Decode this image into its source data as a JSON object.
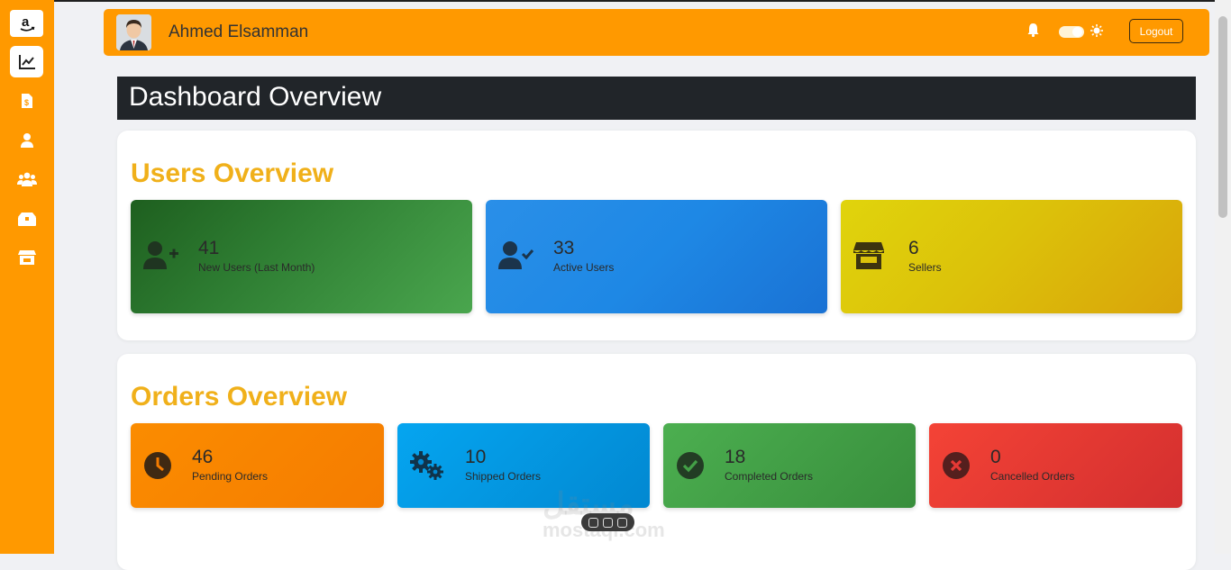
{
  "header": {
    "user_name": "Ahmed Elsamman",
    "logout_label": "Logout"
  },
  "page_title": "Dashboard Overview",
  "users_overview": {
    "title": "Users Overview",
    "cards": [
      {
        "value": "41",
        "label": "New Users (Last Month)",
        "icon": "user-plus-icon",
        "color": "#2e7d32"
      },
      {
        "value": "33",
        "label": "Active Users",
        "icon": "user-check-icon",
        "color": "#1e88e5"
      },
      {
        "value": "6",
        "label": "Sellers",
        "icon": "store-icon",
        "color": "#dcc20a"
      }
    ]
  },
  "orders_overview": {
    "title": "Orders Overview",
    "cards": [
      {
        "value": "46",
        "label": "Pending Orders",
        "icon": "clock-icon",
        "color": "#f57c00"
      },
      {
        "value": "10",
        "label": "Shipped Orders",
        "icon": "gears-icon",
        "color": "#0288d1"
      },
      {
        "value": "18",
        "label": "Completed Orders",
        "icon": "check-circle-icon",
        "color": "#43a047"
      },
      {
        "value": "0",
        "label": "Cancelled Orders",
        "icon": "times-circle-icon",
        "color": "#e53935"
      }
    ]
  },
  "sidebar": {
    "items": [
      {
        "icon": "amazon-logo-icon"
      },
      {
        "icon": "chart-line-icon",
        "active": true
      },
      {
        "icon": "invoice-dollar-icon"
      },
      {
        "icon": "user-icon"
      },
      {
        "icon": "users-icon"
      },
      {
        "icon": "boxes-icon"
      },
      {
        "icon": "store-icon"
      }
    ]
  },
  "watermark": {
    "text": "مستقل",
    "sub": "mostaql.com"
  },
  "colors": {
    "accent": "#ff9900",
    "title_yellow": "#f0b01a",
    "dark": "#212529"
  }
}
